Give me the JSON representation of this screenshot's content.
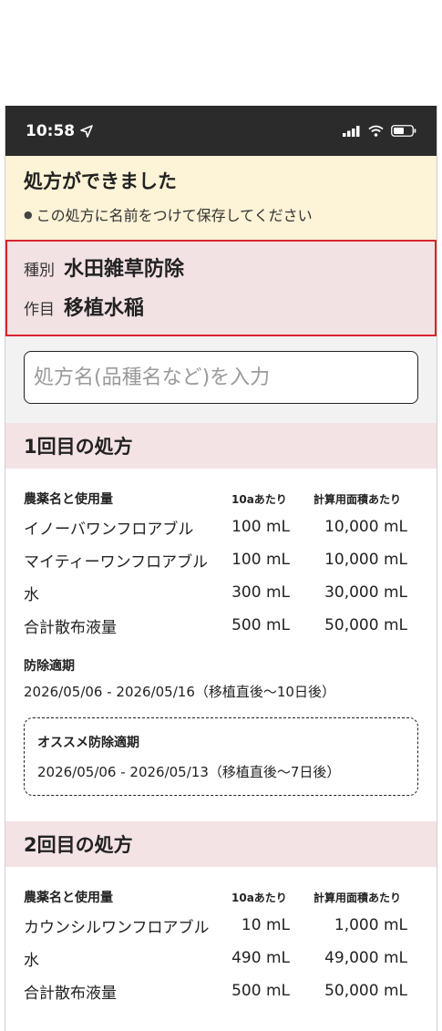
{
  "status_bar": {
    "time": "10:58",
    "location_icon": "location-arrow-icon",
    "signal_icon": "signal-bars-icon",
    "wifi_icon": "wifi-icon",
    "battery_icon": "battery-icon"
  },
  "notice": {
    "title": "処方ができました",
    "message": "この処方に名前をつけて保存してください"
  },
  "info": {
    "type_label": "種別",
    "type_value": "水田雑草防除",
    "crop_label": "作目",
    "crop_value": "移植水稲"
  },
  "name_input": {
    "placeholder": "処方名(品種名など)を入力",
    "value": ""
  },
  "prescriptions": [
    {
      "heading": "1回目の処方",
      "columns": [
        "農薬名と使用量",
        "10aあたり",
        "計算用面積あたり"
      ],
      "rows": [
        [
          "イノーバワンフロアブル",
          "100 mL",
          "10,000 mL"
        ],
        [
          "マイティーワンフロアブル",
          "100 mL",
          "10,000 mL"
        ],
        [
          "水",
          "300 mL",
          "30,000 mL"
        ],
        [
          "合計散布液量",
          "500 mL",
          "50,000 mL"
        ]
      ],
      "period_label": "防除適期",
      "period_value": "2026/05/06 - 2026/05/16（移植直後〜10日後）",
      "recommended_label": "オススメ防除適期",
      "recommended_value": "2026/05/06 - 2026/05/13（移植直後〜7日後）"
    },
    {
      "heading": "2回目の処方",
      "columns": [
        "農薬名と使用量",
        "10aあたり",
        "計算用面積あたり"
      ],
      "rows": [
        [
          "カウンシルワンフロアブル",
          "10 mL",
          "1,000 mL"
        ],
        [
          "水",
          "490 mL",
          "49,000 mL"
        ],
        [
          "合計散布液量",
          "500 mL",
          "50,000 mL"
        ]
      ]
    }
  ],
  "colors": {
    "status_bar": "#2b2b2b",
    "notice_bg": "#fdf3d6",
    "info_bg": "#f3e2e4",
    "info_border": "#d9232e",
    "section_bg": "#f4e3e5"
  }
}
